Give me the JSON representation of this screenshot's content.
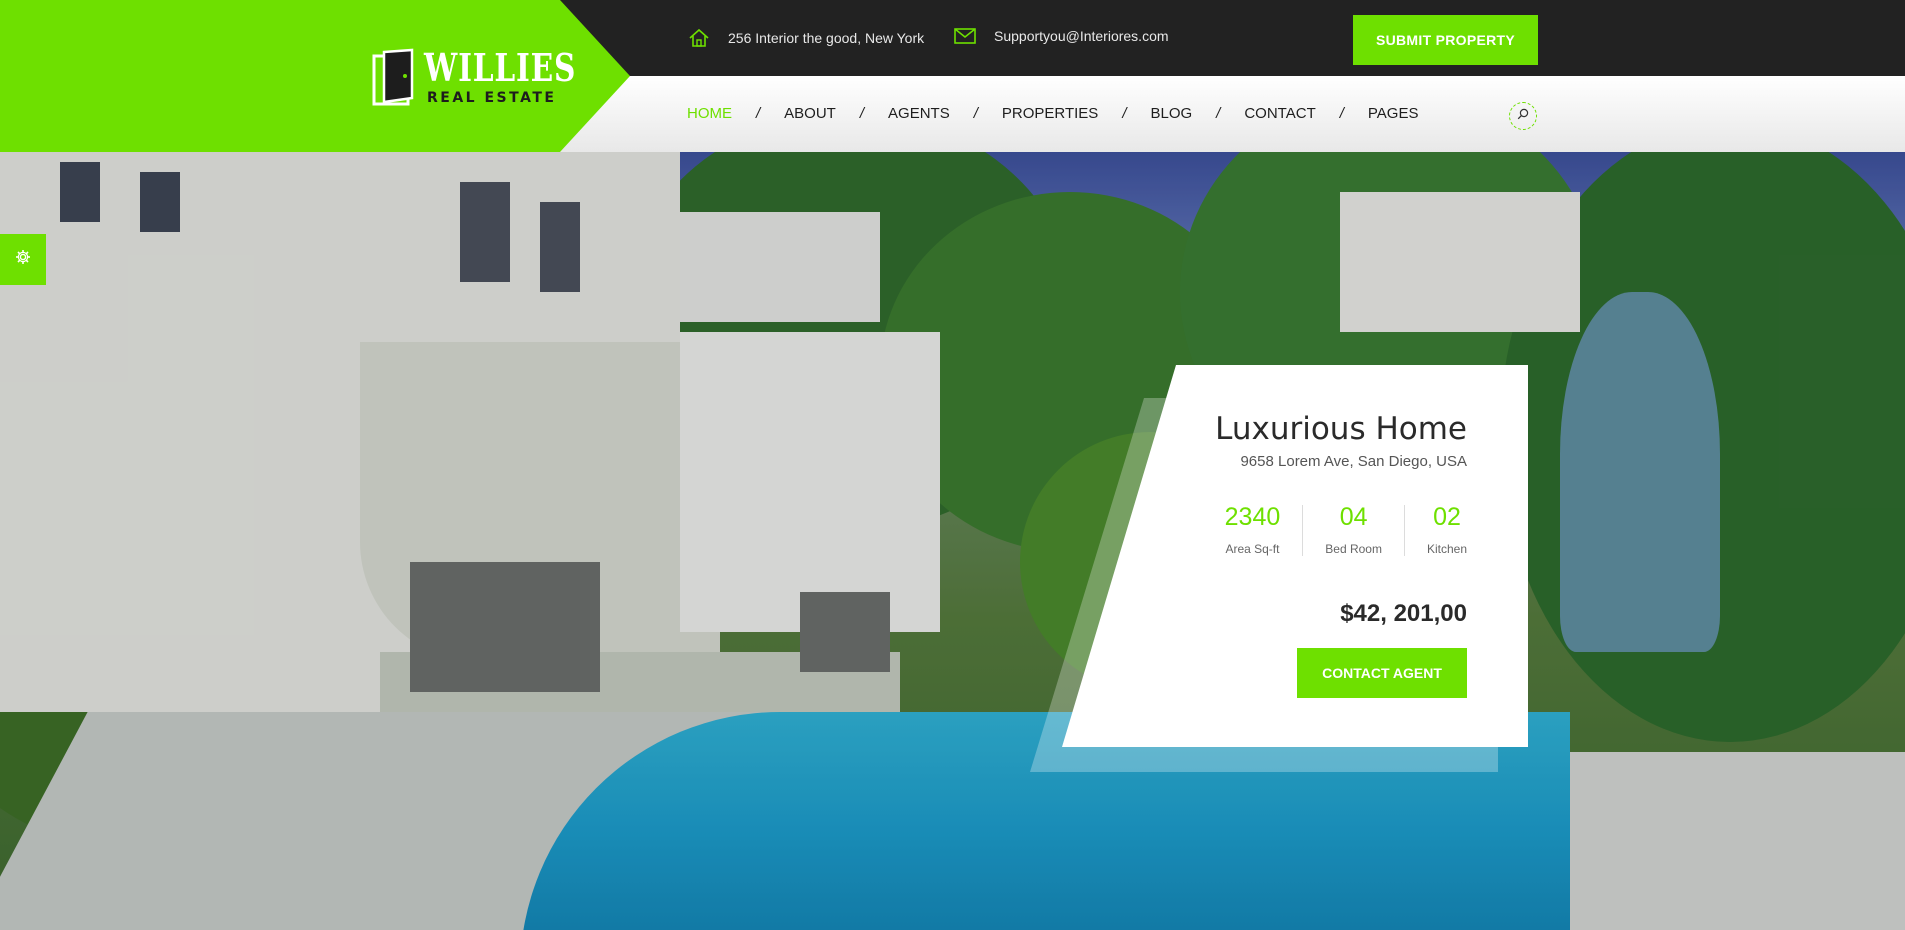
{
  "brand": {
    "name": "WILLIES",
    "tagline": "REAL ESTATE",
    "accent_color": "#6ee000",
    "logo_icon": "door-icon"
  },
  "topbar": {
    "address": "256 Interior the good, New York",
    "address_icon": "home-icon",
    "email": "Supportyou@Interiores.com",
    "email_icon": "mail-icon",
    "submit_label": "SUBMIT PROPERTY"
  },
  "nav": {
    "items": [
      {
        "label": "HOME",
        "active": true
      },
      {
        "label": "ABOUT"
      },
      {
        "label": "AGENTS"
      },
      {
        "label": "PROPERTIES"
      },
      {
        "label": "BLOG"
      },
      {
        "label": "CONTACT"
      },
      {
        "label": "PAGES"
      }
    ],
    "separator": "/",
    "search_icon": "search-icon"
  },
  "side": {
    "settings_icon": "gear-icon"
  },
  "property": {
    "title": "Luxurious Home",
    "address": "9658 Lorem Ave, San Diego, USA",
    "stats": [
      {
        "value": "2340",
        "label": "Area Sq-ft"
      },
      {
        "value": "04",
        "label": "Bed Room"
      },
      {
        "value": "02",
        "label": "Kitchen"
      }
    ],
    "price": "$42, 201,00",
    "contact_label": "CONTACT AGENT"
  }
}
